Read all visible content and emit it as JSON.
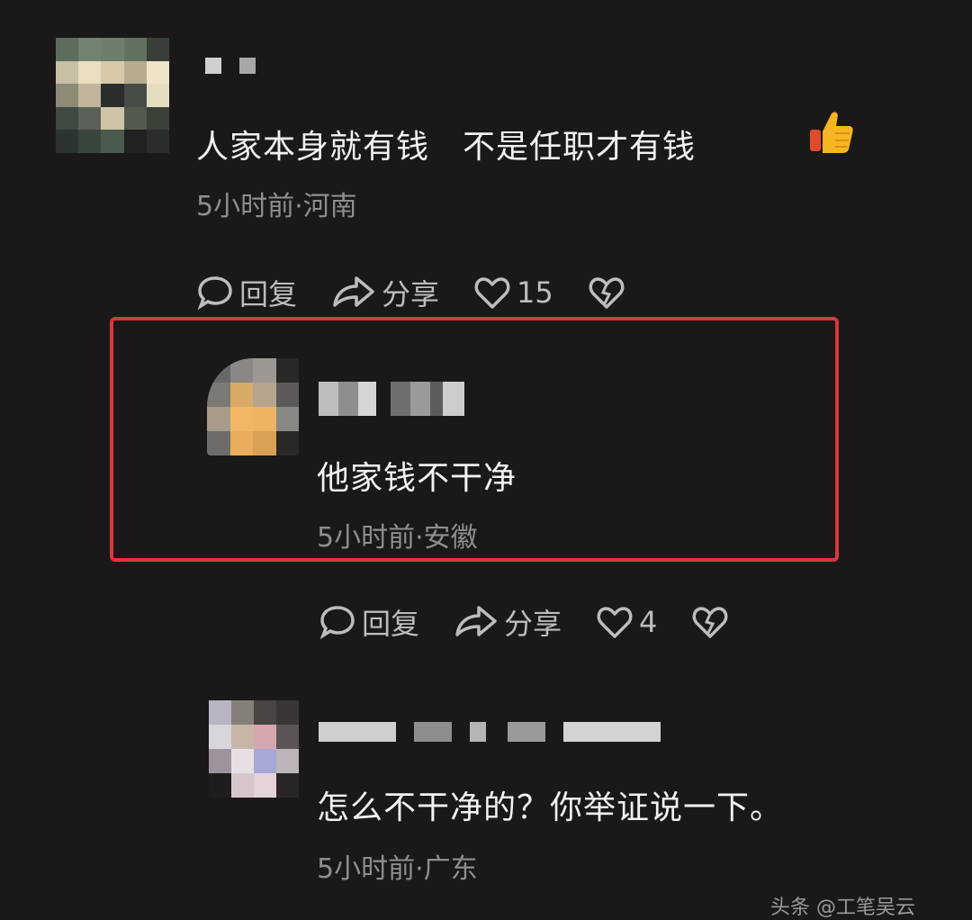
{
  "comments": [
    {
      "text": "人家本身就有钱　不是任职才有钱",
      "meta": "5小时前·河南",
      "reply_label": "回复",
      "share_label": "分享",
      "like_count": "15"
    },
    {
      "text": "他家钱不干净",
      "meta": "5小时前·安徽",
      "reply_label": "回复",
      "share_label": "分享",
      "like_count": "4"
    },
    {
      "text": "怎么不干净的？你举证说一下。",
      "meta": "5小时前·广东"
    }
  ],
  "watermark": "头条 @工笔吴云",
  "icons": {
    "reply": "comment-bubble-icon",
    "share": "share-arrow-icon",
    "like": "heart-icon",
    "dislike": "broken-heart-icon",
    "emoji": "thumbs-up-icon"
  },
  "colors": {
    "background": "#1b1819",
    "highlight": "#d8383a"
  }
}
